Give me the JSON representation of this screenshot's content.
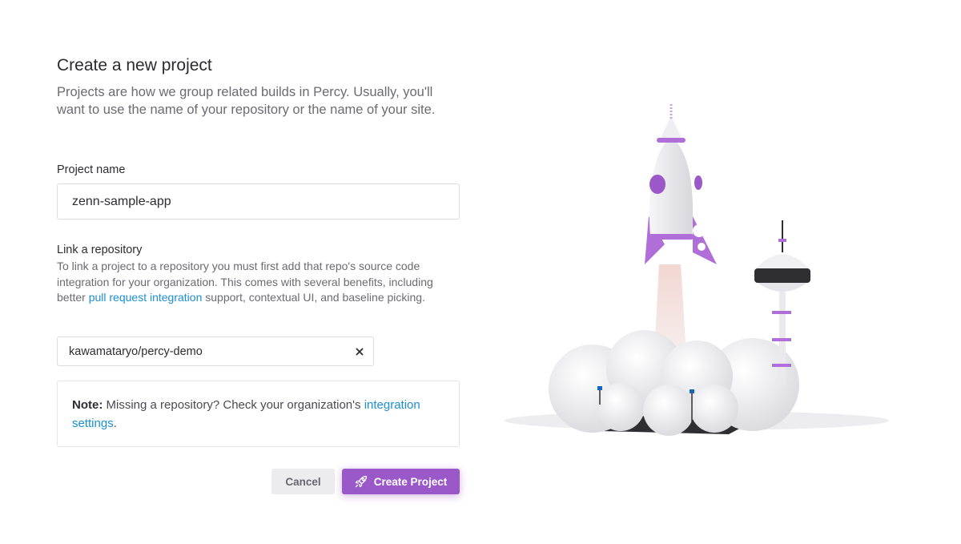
{
  "page": {
    "title": "Create a new project",
    "subtitle": "Projects are how we group related builds in Percy. Usually, you'll want to use the name of your repository or the name of your site."
  },
  "project_name": {
    "label": "Project name",
    "value": "zenn-sample-app"
  },
  "repository": {
    "label": "Link a repository",
    "desc_before": "To link a project to a repository you must first add that repo's source code integration for your organization. This comes with several benefits, including better ",
    "desc_link": "pull request integration",
    "desc_after": " support, contextual UI, and baseline picking.",
    "selected": "kawamataryo/percy-demo",
    "clear_icon": "close-icon"
  },
  "note": {
    "bold": "Note:",
    "text": " Missing a repository? Check your organization's ",
    "link": "integration settings",
    "end": "."
  },
  "actions": {
    "cancel": "Cancel",
    "create": "Create Project",
    "create_icon": "rocket-icon"
  },
  "colors": {
    "accent": "#9a58c9",
    "link": "#1a8fd6",
    "muted_text": "#6b6b73"
  }
}
